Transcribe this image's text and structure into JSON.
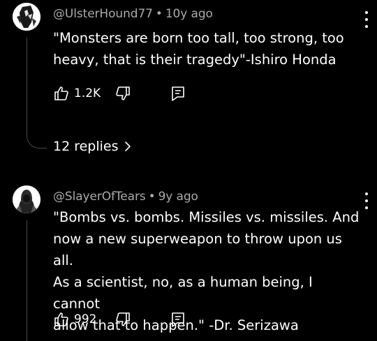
{
  "comments": [
    {
      "author": "@UlsterHound77",
      "age": "10y ago",
      "text": "\"Monsters are born too tall, too strong, too\nheavy, that is their tragedy\"-Ishiro Honda",
      "likes": "1.2K",
      "replies_label": "12 replies",
      "avatar_icon": "masked-figure-avatar"
    },
    {
      "author": "@SlayerOfTears",
      "age": "9y ago",
      "text": "\"Bombs vs. bombs. Missiles vs. missiles. And\nnow a new superweapon to throw upon us all.\nAs a scientist, no, as a human being, I cannot\nallow that to happen.\" -Dr. Serizawa",
      "likes": "992",
      "avatar_icon": "hooded-figure-avatar"
    }
  ],
  "separator": "•",
  "icons": {
    "like": "thumbs-up-icon",
    "dislike": "thumbs-down-icon",
    "reply": "reply-comment-icon",
    "more": "kebab-menu-icon",
    "expand": "chevron-right-icon"
  },
  "colors": {
    "background": "#000000",
    "meta_text": "#aaaaaa",
    "primary_text": "#ffffff",
    "thread_line": "#4a4a4a"
  }
}
